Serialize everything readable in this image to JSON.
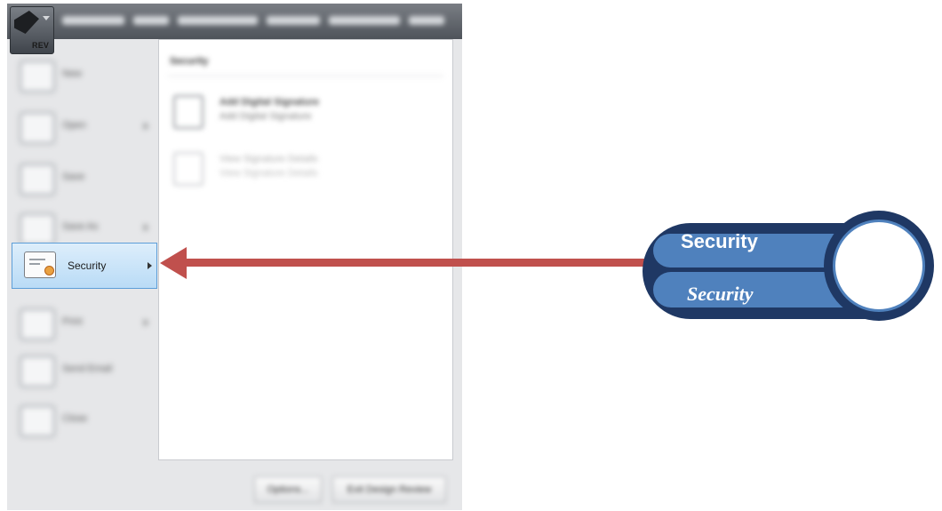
{
  "app": {
    "label": "REV",
    "title_bar_text": ""
  },
  "menu": {
    "items": [
      {
        "label": "New",
        "has_submenu": false
      },
      {
        "label": "Open",
        "has_submenu": true
      },
      {
        "label": "Save",
        "has_submenu": false
      },
      {
        "label": "Save As",
        "has_submenu": true
      },
      {
        "label": "Security",
        "has_submenu": true,
        "selected": true
      },
      {
        "label": "Print",
        "has_submenu": true
      },
      {
        "label": "Send Email",
        "has_submenu": false
      },
      {
        "label": "Close",
        "has_submenu": false
      }
    ]
  },
  "submenu": {
    "header": "Security",
    "commands": [
      {
        "title": "Add Digital Signature",
        "description": "Add Digital Signature",
        "enabled": true
      },
      {
        "title": "View Signature Details",
        "description": "View Signature Details",
        "enabled": false
      }
    ],
    "buttons": [
      "Options...",
      "Exit Design Review"
    ]
  },
  "callout": {
    "title": "Security",
    "subtitle": "Security"
  },
  "colors": {
    "arrow": "#c0504d",
    "callout_dark": "#1f3864",
    "callout_light": "#4f81bd",
    "selection": "#b9dbf6"
  }
}
